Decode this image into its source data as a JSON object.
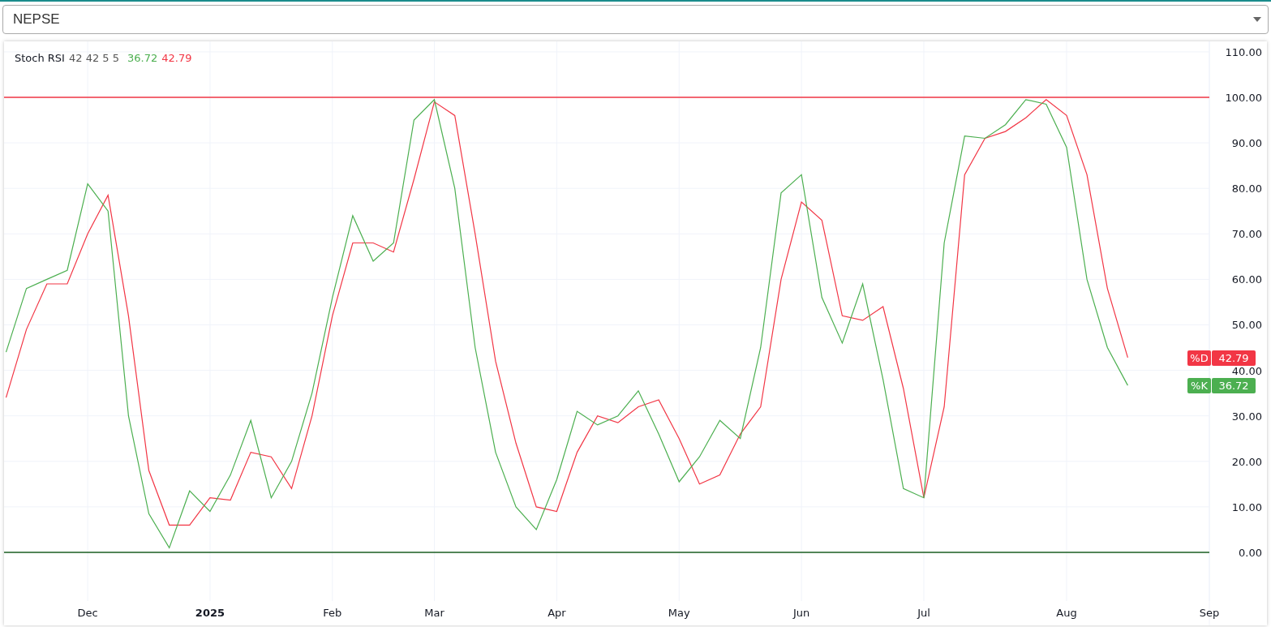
{
  "selector": {
    "value": "NEPSE"
  },
  "indicator": {
    "name": "Stoch RSI",
    "params": "42 42 5 5",
    "values": [
      {
        "text": "36.72",
        "color": "#4caf50"
      },
      {
        "text": "42.79",
        "color": "#f23645"
      }
    ]
  },
  "price_labels": [
    {
      "value": "42.79"
    },
    {
      "value": "36.72"
    }
  ],
  "chart_data": {
    "type": "line",
    "categories": [
      null,
      null,
      null,
      null,
      "Dec",
      null,
      null,
      null,
      null,
      null,
      "2025",
      null,
      null,
      null,
      null,
      null,
      "Feb",
      null,
      null,
      null,
      null,
      "Mar",
      null,
      null,
      null,
      null,
      null,
      "Apr",
      null,
      null,
      null,
      null,
      null,
      "May",
      null,
      null,
      null,
      null,
      null,
      "Jun",
      null,
      null,
      null,
      null,
      null,
      "Jul",
      null,
      null,
      null,
      null,
      null,
      null,
      "Aug",
      null,
      null,
      null,
      null,
      null,
      null,
      "Sep"
    ],
    "series": [
      {
        "name": "%D",
        "color": "#f23645",
        "values": [
          34,
          49,
          59,
          59,
          70,
          78.5,
          52,
          18,
          6,
          6,
          12,
          11.5,
          22,
          21,
          14,
          30,
          52,
          68,
          68,
          66,
          82,
          99,
          96,
          70,
          42,
          24,
          10,
          9,
          22,
          30,
          28.5,
          32,
          33.5,
          25,
          15,
          17,
          26,
          32,
          60,
          77,
          73,
          52,
          51,
          54,
          36,
          12,
          32,
          83,
          91,
          92.5,
          95.5,
          99.5,
          96,
          83,
          58,
          42.8,
          null,
          null,
          null,
          null
        ]
      },
      {
        "name": "%K",
        "color": "#4caf50",
        "values": [
          44,
          58,
          60,
          62,
          81,
          75,
          30,
          8.5,
          1,
          13.5,
          9,
          17,
          29,
          12,
          20,
          35,
          56,
          74,
          64,
          68,
          95,
          99.5,
          80,
          45,
          22,
          10,
          5,
          16,
          31,
          28,
          30,
          35.5,
          26,
          15.5,
          21,
          29,
          25,
          45,
          79,
          83,
          56,
          46,
          59,
          38,
          14,
          12,
          68,
          91.5,
          91,
          94,
          99.5,
          98.5,
          89,
          60,
          45,
          36.7,
          null,
          null,
          null,
          null
        ]
      }
    ],
    "ylim": [
      -10.7,
      112.3
    ],
    "yticks": [
      {
        "value": 0,
        "label": "0.00"
      },
      {
        "value": 10,
        "label": "10.00"
      },
      {
        "value": 20,
        "label": "20.00"
      },
      {
        "value": 30,
        "label": "30.00"
      },
      {
        "value": 40,
        "label": "40.00"
      },
      {
        "value": 50,
        "label": "50.00"
      },
      {
        "value": 60,
        "label": "60.00"
      },
      {
        "value": 70,
        "label": "70.00"
      },
      {
        "value": 80,
        "label": "80.00"
      },
      {
        "value": 90,
        "label": "90.00"
      },
      {
        "value": 100,
        "label": "100.00"
      },
      {
        "value": 110,
        "label": "110.00"
      }
    ],
    "grid": true,
    "legend": true,
    "ref_lines": [
      {
        "axis": "y",
        "value": 100,
        "color": "#f23645"
      },
      {
        "axis": "y",
        "value": 0,
        "color": "#1b5e20"
      }
    ]
  }
}
